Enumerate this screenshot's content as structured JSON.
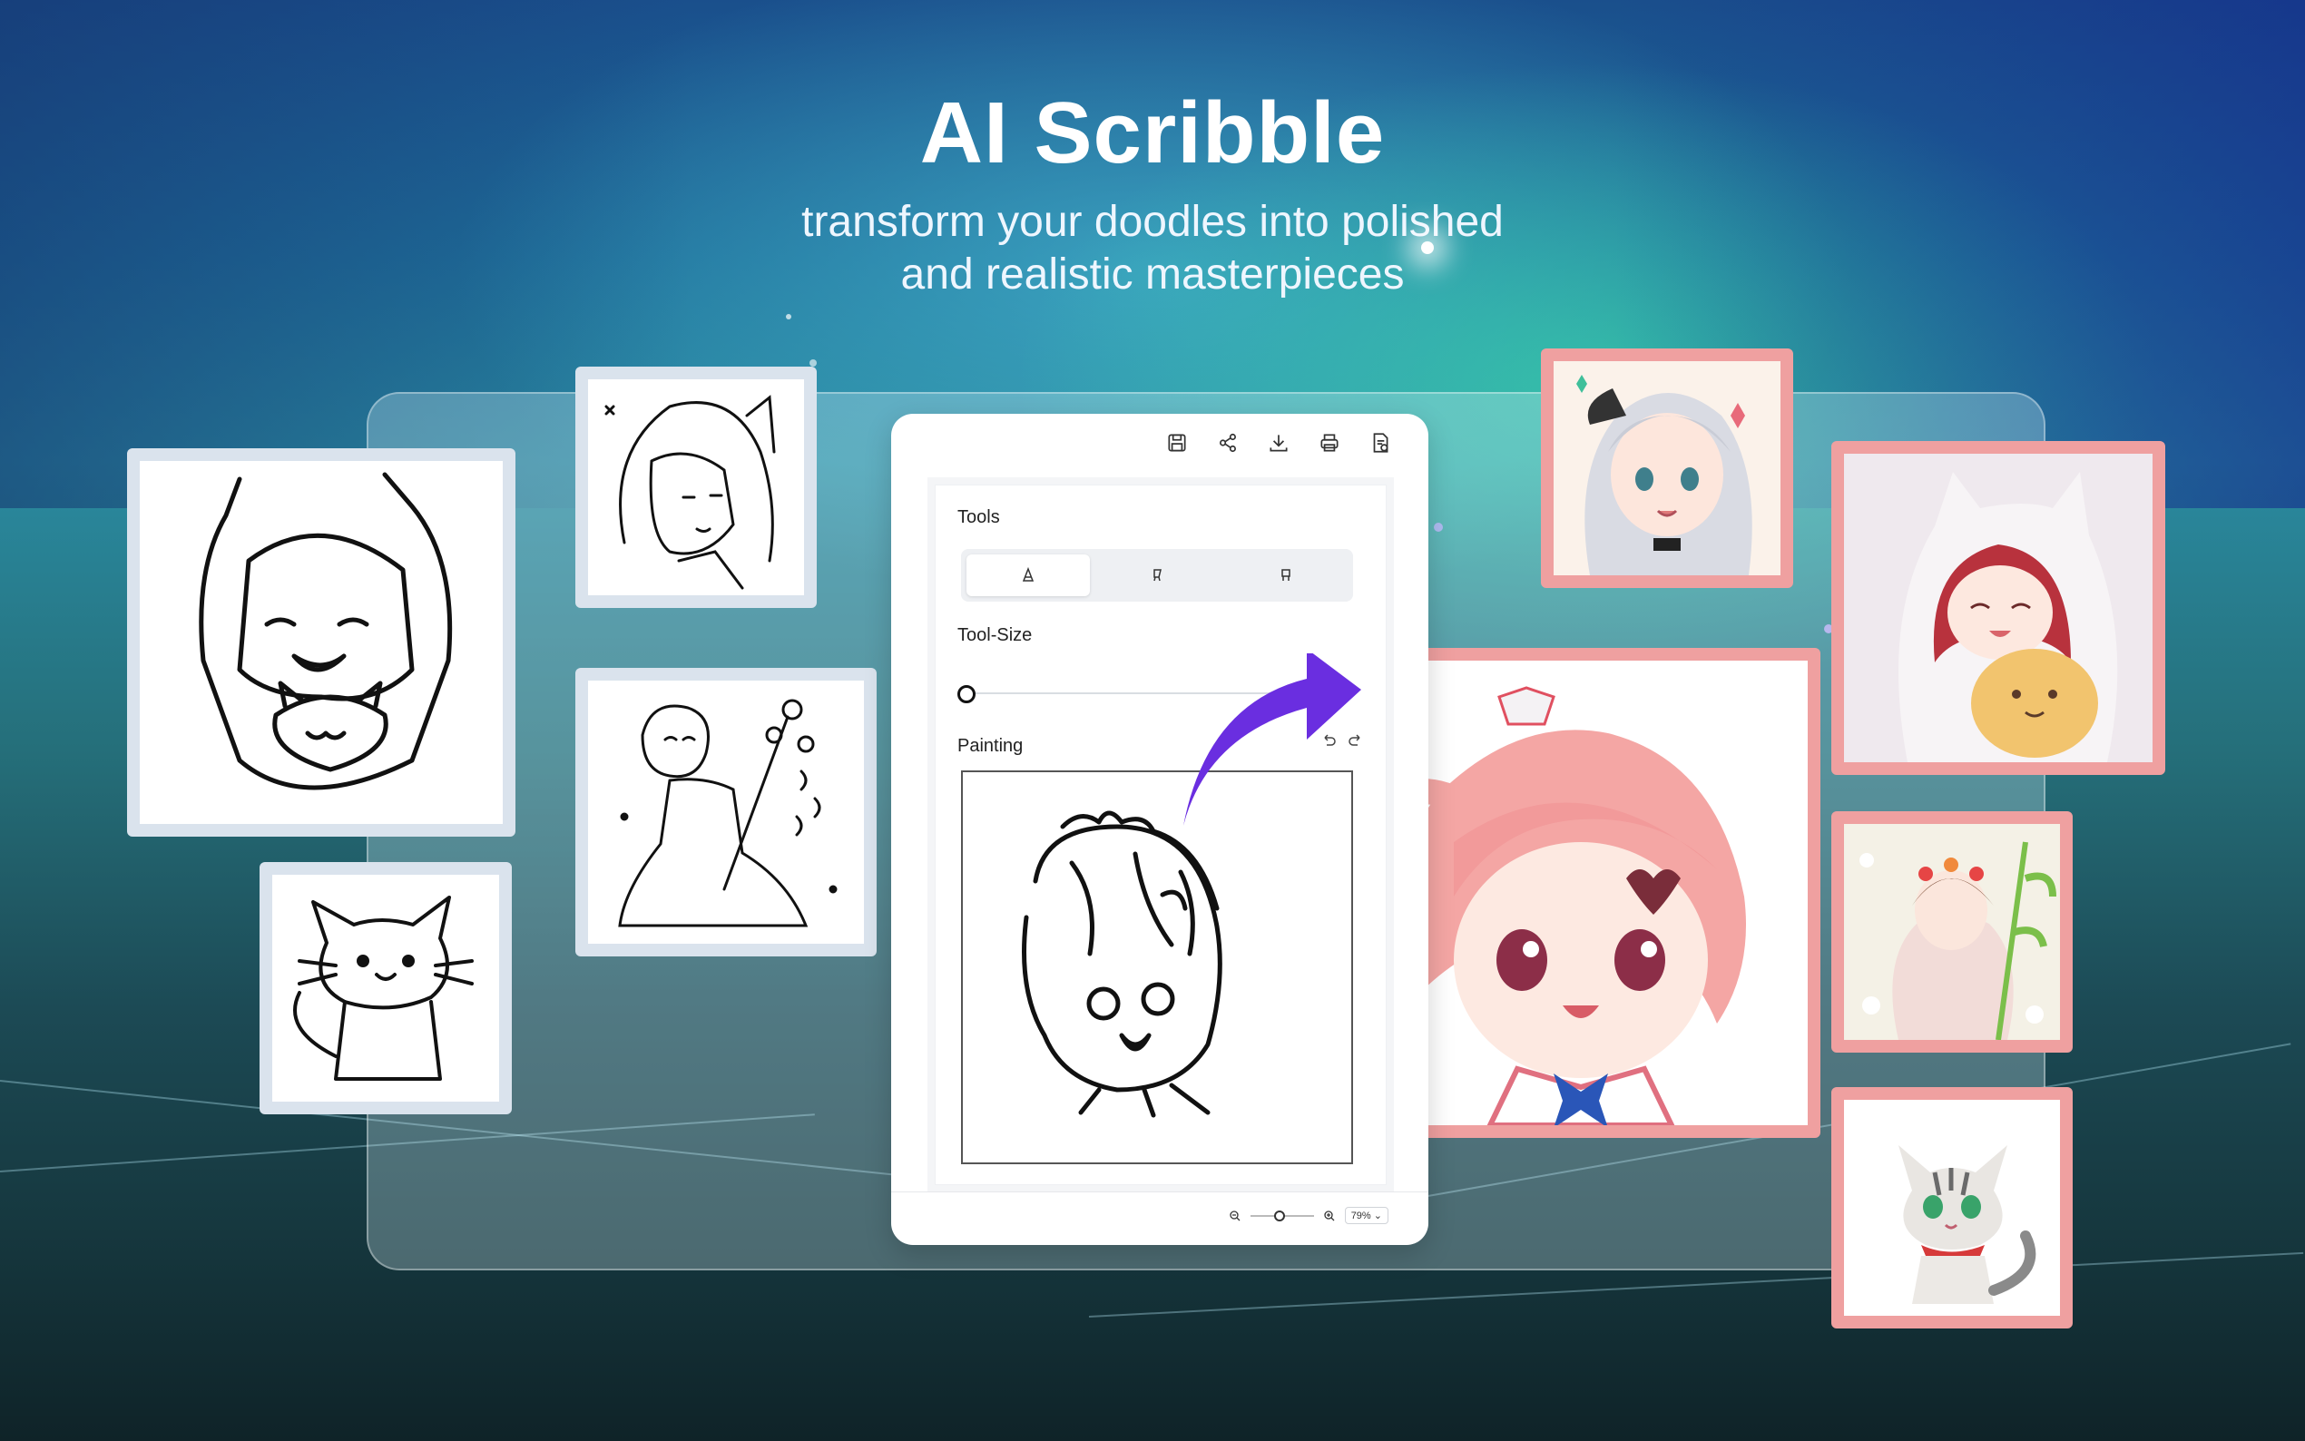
{
  "hero": {
    "title": "AI Scribble",
    "subtitle_line1": "transform your doodles into polished",
    "subtitle_line2": "and realistic masterpieces"
  },
  "app": {
    "toolbar_icons": [
      "save-icon",
      "share-icon",
      "download-icon",
      "print-icon",
      "report-icon"
    ],
    "tools_label": "Tools",
    "tool_buttons": [
      "pencil-icon",
      "marker-icon",
      "eraser-icon"
    ],
    "tool_size_label": "Tool-Size",
    "painting_label": "Painting",
    "zoom_value": "79%"
  },
  "colors": {
    "accent_arrow": "#6a2ee0",
    "sketch_frame": "#d7e1eb",
    "result_frame": "#efa0a0"
  },
  "gallery": {
    "sketches": [
      "hooded-girl-with-cat-sketch",
      "cat-sketch",
      "long-hair-girl-sketch",
      "girl-with-flowers-sketch"
    ],
    "results": [
      "silver-hair-girl-image",
      "red-hood-girl-with-cat-image",
      "pink-hair-girl-image",
      "girl-in-flowers-image",
      "tabby-cat-image"
    ]
  }
}
